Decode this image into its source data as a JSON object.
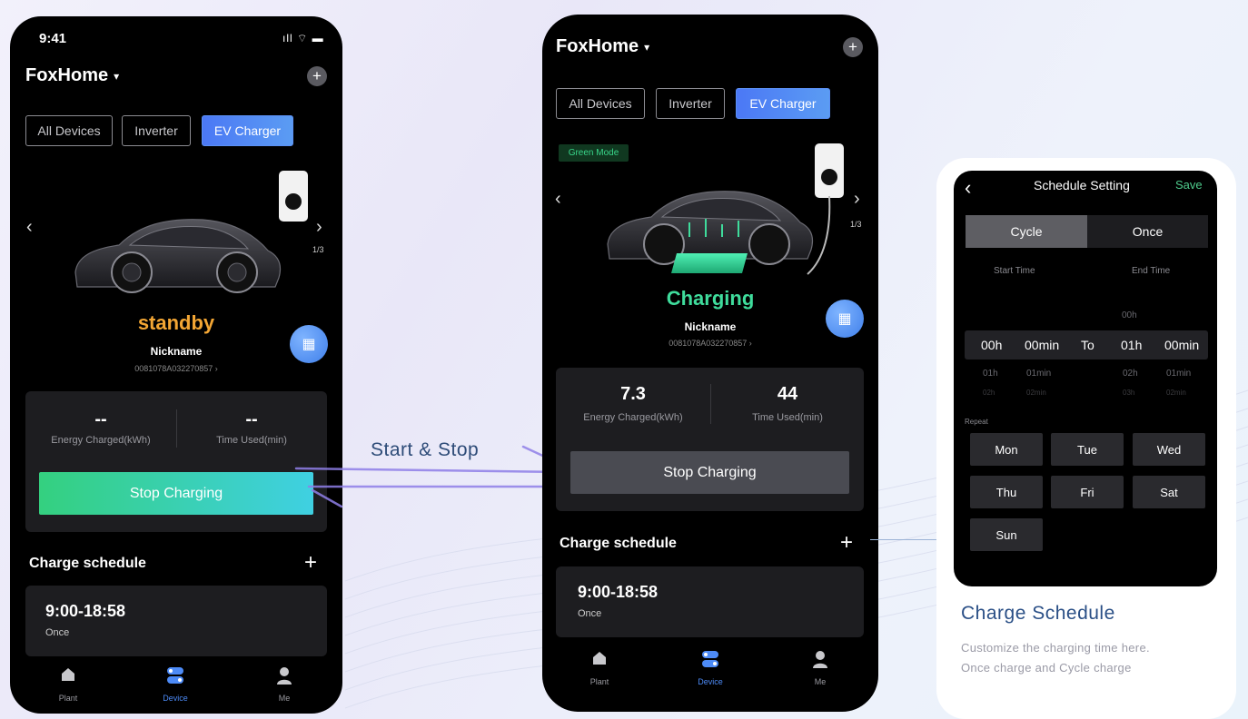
{
  "phone1": {
    "status": {
      "time": "9:41",
      "icons": "ıll ⌔ ▬"
    },
    "home": {
      "title": "FoxHome",
      "caret": "▾",
      "add": "+"
    },
    "tabs": [
      {
        "label": "All Devices"
      },
      {
        "label": "Inverter"
      },
      {
        "label": "EV Charger"
      }
    ],
    "carousel": {
      "prev": "‹",
      "next": "›",
      "page": "1/3"
    },
    "charger": {
      "status": "standby",
      "status_color": "#f3a634",
      "nickname": "Nickname",
      "serial": "0081078A032270857 ›"
    },
    "stats": {
      "energy_value": "--",
      "energy_label": "Energy Charged(kWh)",
      "time_value": "--",
      "time_label": "Time Used(min)"
    },
    "action_button": "Stop Charging",
    "schedule": {
      "title": "Charge schedule",
      "add": "+",
      "time": "9:00-18:58",
      "type": "Once"
    },
    "nav": [
      {
        "label": "Plant"
      },
      {
        "label": "Device"
      },
      {
        "label": "Me"
      }
    ]
  },
  "phone2": {
    "home": {
      "title": "FoxHome",
      "caret": "▾",
      "add": "+"
    },
    "tabs": [
      {
        "label": "All Devices"
      },
      {
        "label": "Inverter"
      },
      {
        "label": "EV Charger"
      }
    ],
    "mode_badge": "Green Mode",
    "carousel": {
      "prev": "‹",
      "next": "›",
      "page": "1/3"
    },
    "charger": {
      "status": "Charging",
      "status_color": "#3fdc9c",
      "nickname": "Nickname",
      "serial": "0081078A032270857 ›"
    },
    "stats": {
      "energy_value": "7.3",
      "energy_label": "Energy Charged(kWh)",
      "time_value": "44",
      "time_label": "Time Used(min)"
    },
    "action_button": "Stop Charging",
    "schedule": {
      "title": "Charge schedule",
      "add": "+",
      "time": "9:00-18:58",
      "type": "Once"
    },
    "nav": [
      {
        "label": "Plant"
      },
      {
        "label": "Device"
      },
      {
        "label": "Me"
      }
    ]
  },
  "annotation": {
    "start_stop": "Start & Stop"
  },
  "schedule_setting": {
    "back": "‹",
    "title": "Schedule Setting",
    "save": "Save",
    "segments": [
      {
        "label": "Cycle"
      },
      {
        "label": "Once"
      }
    ],
    "start_label": "Start Time",
    "end_label": "End Time",
    "above_end_hour": "00h",
    "selected": {
      "start_hour": "00h",
      "start_min": "00min",
      "to": "To",
      "end_hour": "01h",
      "end_min": "00min"
    },
    "below1": {
      "start_hour": "01h",
      "start_min": "01min",
      "end_hour": "02h",
      "end_min": "01min"
    },
    "below2": {
      "start_hour": "02h",
      "start_min": "02min",
      "end_hour": "03h",
      "end_min": "02min"
    },
    "repeat_label": "Repeat",
    "days": [
      {
        "label": "Mon"
      },
      {
        "label": "Tue"
      },
      {
        "label": "Wed"
      },
      {
        "label": "Thu"
      },
      {
        "label": "Fri"
      },
      {
        "label": "Sat"
      },
      {
        "label": "Sun"
      }
    ]
  },
  "charge_schedule_card": {
    "title": "Charge Schedule",
    "desc_line1": "Customize the charging time here.",
    "desc_line2": "Once charge and Cycle charge"
  },
  "colors": {
    "accent_blue": "#4b78f5",
    "accent_green": "#3fdc9c",
    "standby_orange": "#f3a634",
    "save_green": "#4ecb8c"
  }
}
